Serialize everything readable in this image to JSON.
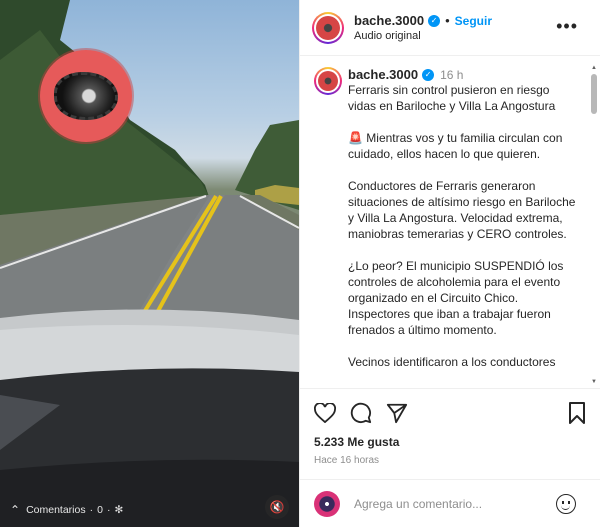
{
  "video": {
    "comments_label": "Comentarios",
    "comments_count": "0",
    "mute_icon": "volume-muted-icon"
  },
  "post": {
    "username": "bache.3000",
    "follow_label": "Seguir",
    "audio_label": "Audio original",
    "time": "16 h",
    "caption": [
      "Ferraris sin control pusieron en riesgo vidas en Bariloche y Villa La Angostura",
      "Mientras vos y tu familia circulan con cuidado, ellos hacen lo que quieren.",
      "Conductores de Ferraris generaron situaciones de altísimo riesgo en Bariloche y Villa La Angostura. Velocidad extrema, maniobras temerarias y CERO controles.",
      "¿Lo peor? El municipio SUSPENDIÓ los controles de alcoholemia para el evento organizado en el Circuito Chico. Inspectores que iban a trabajar fueron frenados a último momento.",
      "Vecinos identificaron a los conductores"
    ],
    "caption_emoji": "🚨",
    "likes": "5.233 Me gusta",
    "ago": "Hace 16 horas",
    "comment_placeholder": "Agrega un comentario...",
    "accent_color": "#0095f6"
  }
}
